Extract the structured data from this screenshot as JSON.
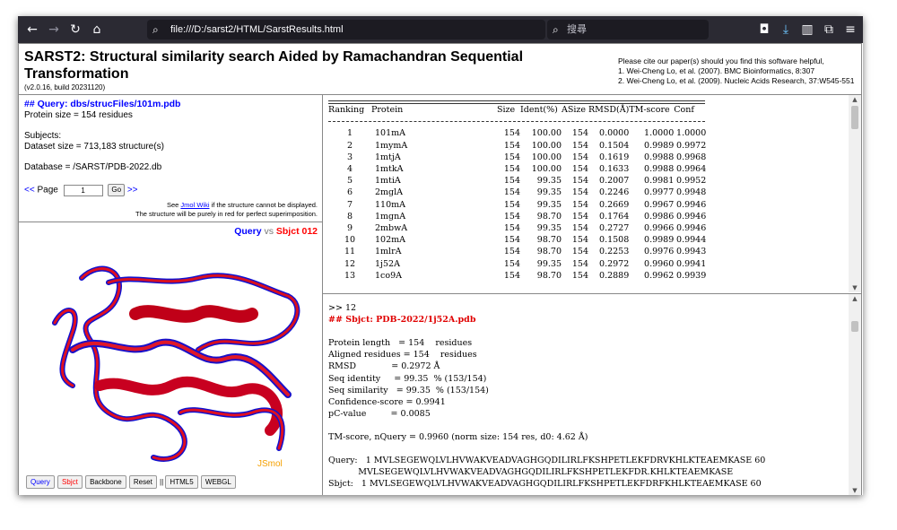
{
  "browser": {
    "url": "file:///D:/sarst2/HTML/SarstResults.html",
    "search_placeholder": "搜尋"
  },
  "header": {
    "title": "SARST2: Structural similarity search Aided by Ramachandran Sequential Transformation",
    "version": "(v2.0.16, build 20231120)",
    "cite_intro": "Please cite our paper(s) should you find this software helpful,",
    "cite_1": "1. Wei-Cheng Lo, et al. (2007). BMC Bioinformatics, 8:307",
    "cite_2": "2. Wei-Cheng Lo, et al. (2009). Nucleic Acids Research, 37:W545-551"
  },
  "query_panel": {
    "query_label": "## Query: dbs/strucFiles/101m.pdb",
    "protein_size": "Protein size = 154 residues",
    "subjects": "Subjects:",
    "dataset_size": "Dataset size = 713,183 structure(s)",
    "database": "Database = /SARST/PDB-2022.db",
    "prev": "<<",
    "page_label": "Page",
    "page_value": "1",
    "go": "Go",
    "next": ">>",
    "note_pre": "See",
    "note_link": "Jmol Wiki",
    "note_post": "if the structure cannot be displayed.",
    "note_2": "The structure will be purely in red for perfect superimposition."
  },
  "viewer": {
    "query": "Query",
    "vs": "vs",
    "sbjct": "Sbjct 012",
    "brand": "JSmol",
    "buttons": [
      "Query",
      "Sbjct",
      "Backbone",
      "Reset",
      "||",
      "HTML5",
      "WEBGL"
    ]
  },
  "results": {
    "headers": [
      "Ranking",
      "Protein",
      "Size",
      "Ident(%)",
      "ASize",
      "RMSD(Å)",
      "TM-score",
      "Conf"
    ],
    "rows": [
      [
        "1",
        "101mA",
        "154",
        "100.00",
        "154",
        "0.0000",
        "1.0000",
        "1.0000"
      ],
      [
        "2",
        "1mymA",
        "154",
        "100.00",
        "154",
        "0.1504",
        "0.9989",
        "0.9972"
      ],
      [
        "3",
        "1mtjA",
        "154",
        "100.00",
        "154",
        "0.1619",
        "0.9988",
        "0.9968"
      ],
      [
        "4",
        "1mtkA",
        "154",
        "100.00",
        "154",
        "0.1633",
        "0.9988",
        "0.9964"
      ],
      [
        "5",
        "1mtiA",
        "154",
        "99.35",
        "154",
        "0.2007",
        "0.9981",
        "0.9952"
      ],
      [
        "6",
        "2mglA",
        "154",
        "99.35",
        "154",
        "0.2246",
        "0.9977",
        "0.9948"
      ],
      [
        "7",
        "110mA",
        "154",
        "99.35",
        "154",
        "0.2669",
        "0.9967",
        "0.9946"
      ],
      [
        "8",
        "1mgnA",
        "154",
        "98.70",
        "154",
        "0.1764",
        "0.9986",
        "0.9946"
      ],
      [
        "9",
        "2mbwA",
        "154",
        "99.35",
        "154",
        "0.2727",
        "0.9966",
        "0.9946"
      ],
      [
        "10",
        "102mA",
        "154",
        "98.70",
        "154",
        "0.1508",
        "0.9989",
        "0.9944"
      ],
      [
        "11",
        "1mlrA",
        "154",
        "98.70",
        "154",
        "0.2253",
        "0.9976",
        "0.9943"
      ],
      [
        "12",
        "1j52A",
        "154",
        "99.35",
        "154",
        "0.2972",
        "0.9960",
        "0.9941"
      ],
      [
        "13",
        "1co9A",
        "154",
        "98.70",
        "154",
        "0.2889",
        "0.9962",
        "0.9939"
      ]
    ]
  },
  "detail": {
    "lines": [
      ">> 12",
      "## Sbjct: PDB-2022/1j52A.pdb",
      "",
      "Protein length   = 154    residues",
      "Aligned residues = 154    residues",
      "RMSD             = 0.2972 Å",
      "Seq identity     = 99.35  % (153/154)",
      "Seq similarity   = 99.35  % (153/154)",
      "Confidence-score = 0.9941",
      "pC-value         = 0.0085",
      "",
      "TM-score, nQuery = 0.9960 (norm size: 154 res, d0: 4.62 Å)",
      "",
      "Query:   1 MVLSEGEWQLVLHVWAKVEADVAGHGQDILIRLFKSHPETLEKFDRVKHLKTEAEMKASE 60",
      "           MVLSEGEWQLVLHVWAKVEADVAGHGQDILIRLFKSHPETLEKFDR.KHLKTEAEMKASE",
      "Sbjct:   1 MVLSEGEWQLVLHVWAKVEADVAGHGQDILIRLFKSHPETLEKFDRFKHLKTEAEMKASE 60"
    ]
  }
}
